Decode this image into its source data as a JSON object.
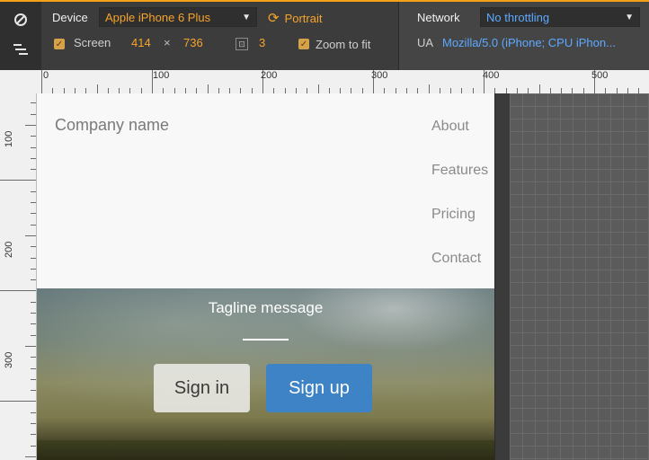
{
  "toolbar": {
    "device_label": "Device",
    "device_value": "Apple iPhone 6 Plus",
    "orientation_label": "Portrait",
    "screen_label": "Screen",
    "screen_width": "414",
    "times": "×",
    "screen_height": "736",
    "dpr_value": "3",
    "zoom_label": "Zoom to fit",
    "network_label": "Network",
    "network_value": "No throttling",
    "ua_label": "UA",
    "ua_value": "Mozilla/5.0 (iPhone; CPU iPhon..."
  },
  "ruler": {
    "top_ticks": [
      "0",
      "100",
      "200",
      "300",
      "400",
      "500"
    ],
    "left_ticks": [
      "100",
      "200",
      "300"
    ]
  },
  "page": {
    "brand": "Company name",
    "nav": [
      "About",
      "Features",
      "Pricing",
      "Contact"
    ],
    "tagline": "Tagline message",
    "signin": "Sign in",
    "signup": "Sign up"
  }
}
